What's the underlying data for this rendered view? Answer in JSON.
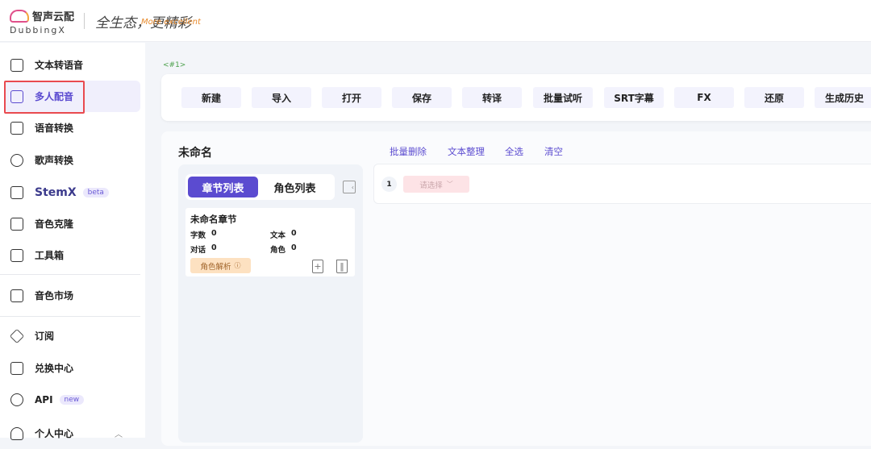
{
  "header": {
    "brand_cn": "智声云配",
    "brand_en": "DubbingX",
    "slogan": "全生态，更精彩",
    "slogan_en": "More excellent"
  },
  "sidebar": {
    "items": [
      {
        "label": "文本转语音",
        "icon": "text-to-speech-icon"
      },
      {
        "label": "多人配音",
        "icon": "multi-dubbing-icon",
        "active": true
      },
      {
        "label": "语音转换",
        "icon": "voice-convert-icon"
      },
      {
        "label": "歌声转换",
        "icon": "singing-convert-icon"
      },
      {
        "label": "StemX",
        "icon": "stemx-icon",
        "badge": "beta"
      },
      {
        "label": "音色克隆",
        "icon": "voice-clone-icon"
      },
      {
        "label": "工具箱",
        "icon": "folder-icon"
      },
      {
        "label": "音色市场",
        "icon": "shopping-bag-icon"
      },
      {
        "label": "订阅",
        "icon": "diamond-icon"
      },
      {
        "label": "兑换中心",
        "icon": "gift-icon"
      },
      {
        "label": "API",
        "icon": "key-icon",
        "badge": "new"
      },
      {
        "label": "个人中心",
        "icon": "user-icon"
      }
    ]
  },
  "tag": "<#1>",
  "toolbar": {
    "buttons": [
      "新建",
      "导入",
      "打开",
      "保存",
      "转译",
      "批量试听",
      "SRT字幕",
      "FX",
      "还原",
      "生成历史"
    ]
  },
  "project": {
    "title": "未命名",
    "actions": [
      "批量删除",
      "文本整理",
      "全选",
      "清空"
    ]
  },
  "panel": {
    "tabs": [
      "章节列表",
      "角色列表"
    ],
    "chapter": {
      "name": "未命名章节",
      "word_count_label": "字数",
      "word_count": "0",
      "text_label": "文本",
      "text_count": "0",
      "dialog_label": "对话",
      "dialog_count": "0",
      "role_label": "角色",
      "role_count": "0",
      "analyze_label": "角色解析"
    }
  },
  "line": {
    "index": "1",
    "select_placeholder": "请选择"
  },
  "colors": {
    "accent": "#5b4bd0",
    "highlight": "#e94a4f"
  }
}
